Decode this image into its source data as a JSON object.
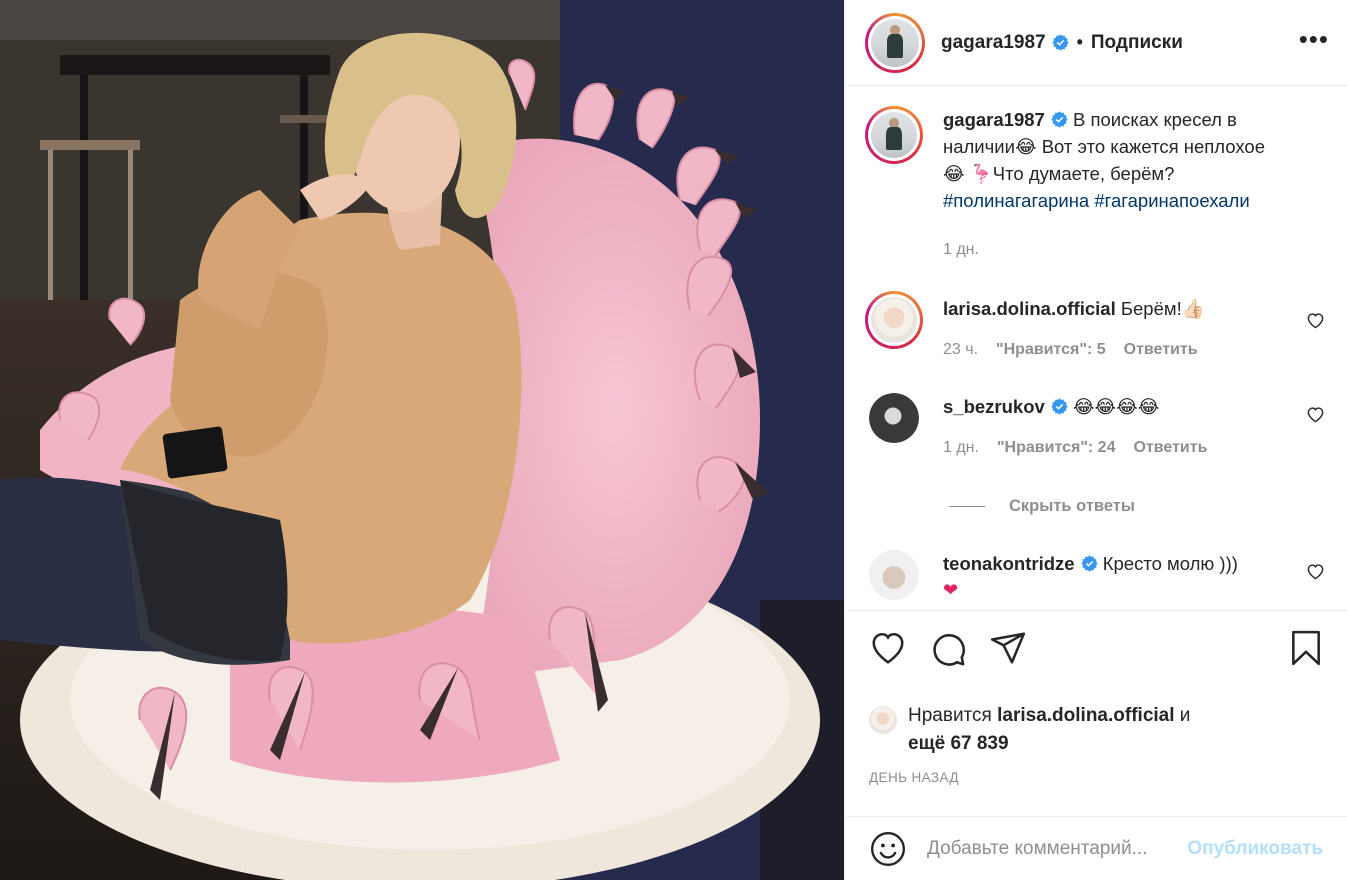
{
  "post": {
    "author": "gagara1987",
    "follow_status": "Подписки",
    "more_label": "•••",
    "caption_text": " В поисках кресел в наличии😂 Вот это кажется неплохое 😂 🦩Что думаете, берём?",
    "caption_hashtags": "#полинагагарина #гагаринапоехали",
    "caption_time": "1 дн."
  },
  "comments": [
    {
      "user": "larisa.dolina.official",
      "verified": false,
      "text": " Берём!👍🏻",
      "time": "23 ч.",
      "likes": "\"Нравится\": 5",
      "reply": "Ответить"
    },
    {
      "user": "s_bezrukov",
      "verified": true,
      "text": " 😂😂😂😂",
      "time": "1 дн.",
      "likes": "\"Нравится\": 24",
      "reply": "Ответить"
    },
    {
      "user": "teonakontridze",
      "verified": true,
      "text": " Кресто молю )))"
    }
  ],
  "hide_replies": "Скрыть ответы",
  "likes": {
    "prefix": "Нравится ",
    "user": "larisa.dolina.official",
    "suffix": " и",
    "count_line": "ещё 67 839"
  },
  "timestamp": "ДЕНЬ НАЗАД",
  "comment_box": {
    "placeholder": "Добавьте комментарий...",
    "post_label": "Опубликовать"
  },
  "colors": {
    "background": "#ffffff",
    "text": "#262626",
    "muted": "#8e8e8e",
    "hashtag": "#00376b",
    "verified": "#3897f0",
    "post_button": "#b2dffc",
    "photo_wall": "#2b2f45",
    "fur_pink": "#f3b8c8",
    "fur_white": "#f3ece4",
    "sweater": "#d9a878"
  },
  "icons": {
    "like": "heart-icon",
    "comment": "comment-bubble-icon",
    "share": "paper-plane-icon",
    "save": "bookmark-icon",
    "emoji": "smiley-icon",
    "verified": "verified-badge-icon"
  }
}
